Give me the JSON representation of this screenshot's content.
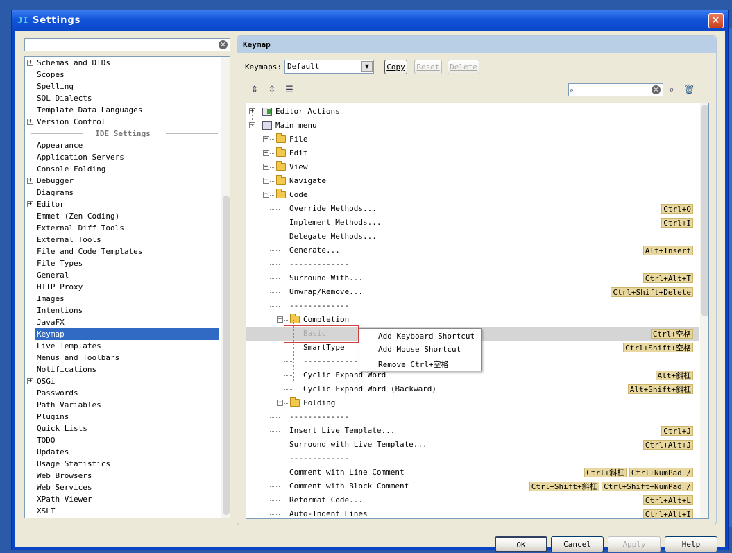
{
  "window": {
    "title": "Settings",
    "app_icon": "JI",
    "close_symbol": "✕"
  },
  "left": {
    "search": {
      "value": "",
      "clear_symbol": "×"
    },
    "items": [
      {
        "label": "Schemas and DTDs",
        "expandable": true
      },
      {
        "label": "Scopes",
        "expandable": false
      },
      {
        "label": "Spelling",
        "expandable": false
      },
      {
        "label": "SQL Dialects",
        "expandable": false
      },
      {
        "label": "Template Data Languages",
        "expandable": false
      },
      {
        "label": "Version Control",
        "expandable": true
      }
    ],
    "section_header": "IDE Settings",
    "ide_items": [
      {
        "label": "Appearance",
        "expandable": false
      },
      {
        "label": "Application Servers",
        "expandable": false
      },
      {
        "label": "Console Folding",
        "expandable": false
      },
      {
        "label": "Debugger",
        "expandable": true
      },
      {
        "label": "Diagrams",
        "expandable": false
      },
      {
        "label": "Editor",
        "expandable": true
      },
      {
        "label": "Emmet (Zen Coding)",
        "expandable": false
      },
      {
        "label": "External Diff Tools",
        "expandable": false
      },
      {
        "label": "External Tools",
        "expandable": false
      },
      {
        "label": "File and Code Templates",
        "expandable": false
      },
      {
        "label": "File Types",
        "expandable": false
      },
      {
        "label": "General",
        "expandable": false
      },
      {
        "label": "HTTP Proxy",
        "expandable": false
      },
      {
        "label": "Images",
        "expandable": false
      },
      {
        "label": "Intentions",
        "expandable": false
      },
      {
        "label": "JavaFX",
        "expandable": false
      },
      {
        "label": "Keymap",
        "expandable": false,
        "selected": true
      },
      {
        "label": "Live Templates",
        "expandable": false
      },
      {
        "label": "Menus and Toolbars",
        "expandable": false
      },
      {
        "label": "Notifications",
        "expandable": false
      },
      {
        "label": "OSGi",
        "expandable": true
      },
      {
        "label": "Passwords",
        "expandable": false
      },
      {
        "label": "Path Variables",
        "expandable": false
      },
      {
        "label": "Plugins",
        "expandable": false
      },
      {
        "label": "Quick Lists",
        "expandable": false
      },
      {
        "label": "TODO",
        "expandable": false
      },
      {
        "label": "Updates",
        "expandable": false
      },
      {
        "label": "Usage Statistics",
        "expandable": false
      },
      {
        "label": "Web Browsers",
        "expandable": false
      },
      {
        "label": "Web Services",
        "expandable": false
      },
      {
        "label": "XPath Viewer",
        "expandable": false
      },
      {
        "label": "XSLT",
        "expandable": false
      }
    ]
  },
  "right": {
    "header": "Keymap",
    "keymaps_label": "Keymaps:",
    "keymap_value": "Default",
    "buttons": {
      "copy": "Copy",
      "reset": "Reset",
      "delete": "Delete"
    },
    "filter_value": "",
    "icons": {
      "expand_all": "expand-all-icon",
      "collapse_all": "collapse-all-icon",
      "edit": "edit-shortcut-icon",
      "find_shortcut": "find-shortcut-icon",
      "trash": "trash-icon"
    },
    "tree": [
      {
        "label": "Editor Actions",
        "level": 0,
        "exp": "+",
        "icon": "editor"
      },
      {
        "label": "Main menu",
        "level": 0,
        "exp": "-",
        "icon": "menu"
      },
      {
        "label": "File",
        "level": 1,
        "exp": "+",
        "icon": "folder"
      },
      {
        "label": "Edit",
        "level": 1,
        "exp": "+",
        "icon": "folder"
      },
      {
        "label": "View",
        "level": 1,
        "exp": "+",
        "icon": "folder"
      },
      {
        "label": "Navigate",
        "level": 1,
        "exp": "+",
        "icon": "folder"
      },
      {
        "label": "Code",
        "level": 1,
        "exp": "-",
        "icon": "folder"
      },
      {
        "label": "Override Methods...",
        "level": 2,
        "shortcuts": [
          "Ctrl+O"
        ]
      },
      {
        "label": "Implement Methods...",
        "level": 2,
        "shortcuts": [
          "Ctrl+I"
        ]
      },
      {
        "label": "Delegate Methods...",
        "level": 2
      },
      {
        "label": "Generate...",
        "level": 2,
        "shortcuts": [
          "Alt+Insert"
        ]
      },
      {
        "label": "-------------",
        "level": 2
      },
      {
        "label": "Surround With...",
        "level": 2,
        "shortcuts": [
          "Ctrl+Alt+T"
        ]
      },
      {
        "label": "Unwrap/Remove...",
        "level": 2,
        "shortcuts": [
          "Ctrl+Shift+Delete"
        ]
      },
      {
        "label": "-------------",
        "level": 2
      },
      {
        "label": "Completion",
        "level": 2,
        "exp": "-",
        "icon": "folder"
      },
      {
        "label": "Basic",
        "level": 3,
        "shortcuts": [
          "Ctrl+空格"
        ],
        "selected": true
      },
      {
        "label": "SmartType",
        "level": 3,
        "shortcuts": [
          "Ctrl+Shift+空格"
        ]
      },
      {
        "label": "-------------",
        "level": 3
      },
      {
        "label": "Cyclic Expand Word",
        "level": 3,
        "shortcuts": [
          "Alt+斜杠"
        ]
      },
      {
        "label": "Cyclic Expand Word (Backward)",
        "level": 3,
        "shortcuts": [
          "Alt+Shift+斜杠"
        ]
      },
      {
        "label": "Folding",
        "level": 2,
        "exp": "+",
        "icon": "folder"
      },
      {
        "label": "-------------",
        "level": 2
      },
      {
        "label": "Insert Live Template...",
        "level": 2,
        "shortcuts": [
          "Ctrl+J"
        ]
      },
      {
        "label": "Surround with Live Template...",
        "level": 2,
        "shortcuts": [
          "Ctrl+Alt+J"
        ]
      },
      {
        "label": "-------------",
        "level": 2
      },
      {
        "label": "Comment with Line Comment",
        "level": 2,
        "shortcuts": [
          "Ctrl+斜杠",
          "Ctrl+NumPad /"
        ]
      },
      {
        "label": "Comment with Block Comment",
        "level": 2,
        "shortcuts": [
          "Ctrl+Shift+斜杠",
          "Ctrl+Shift+NumPad /"
        ]
      },
      {
        "label": "Reformat Code...",
        "level": 2,
        "shortcuts": [
          "Ctrl+Alt+L"
        ]
      },
      {
        "label": "Auto-Indent Lines",
        "level": 2,
        "shortcuts": [
          "Ctrl+Alt+I"
        ]
      }
    ],
    "context_menu": {
      "add_keyboard": "Add Keyboard Shortcut",
      "add_mouse": "Add Mouse Shortcut",
      "remove": "Remove Ctrl+空格"
    }
  },
  "footer": {
    "ok": "OK",
    "cancel": "Cancel",
    "apply": "Apply",
    "help": "Help"
  }
}
